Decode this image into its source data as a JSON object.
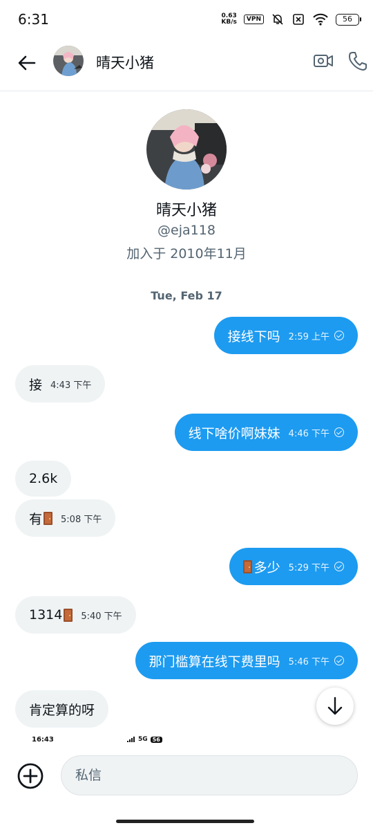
{
  "status_bar": {
    "time": "6:31",
    "net_speed_value": "0.63",
    "net_speed_unit": "KB/s",
    "vpn_label": "VPN",
    "battery": "56"
  },
  "header": {
    "contact_name": "晴天小猪"
  },
  "profile": {
    "name": "晴天小猪",
    "handle": "@eja118",
    "joined": "加入于 2010年11月"
  },
  "date_separator": "Tue, Feb 17",
  "messages": [
    {
      "dir": "out",
      "text": "接线下吗",
      "time": "2:59 上午"
    },
    {
      "dir": "in",
      "text": "接",
      "time": "4:43 下午"
    },
    {
      "dir": "out",
      "text": "线下啥价啊妹妹",
      "time": "4:46 下午"
    },
    {
      "dir": "in",
      "text": "2.6k",
      "time": ""
    },
    {
      "dir": "in",
      "text": "有",
      "time": "5:08 下午"
    },
    {
      "dir": "out",
      "text": "多少",
      "time": "5:29 下午"
    },
    {
      "dir": "in",
      "text": "1314",
      "time": "5:40 下午"
    },
    {
      "dir": "out",
      "text": "那门槛算在线下费里吗",
      "time": "5:46 下午"
    },
    {
      "dir": "in",
      "text": "肯定算的呀",
      "time": ""
    }
  ],
  "mini_status": {
    "time": "16:43",
    "network": "5G",
    "battery": "56"
  },
  "composer": {
    "placeholder": "私信"
  },
  "colors": {
    "accent": "#1d9bf0",
    "incoming_bubble": "#eff3f4",
    "secondary_text": "#536471"
  }
}
